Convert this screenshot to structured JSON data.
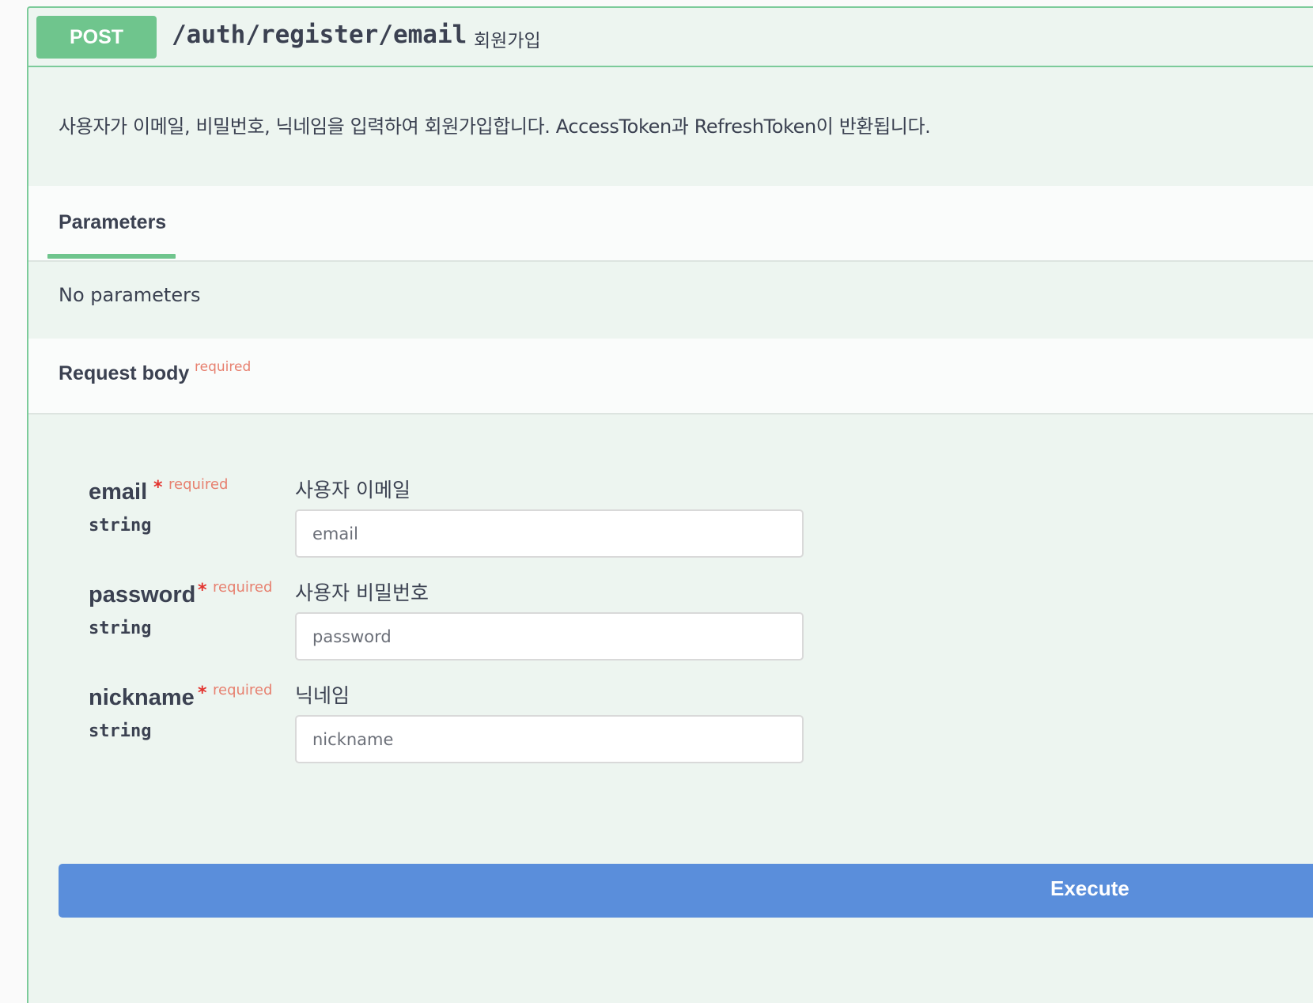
{
  "operation": {
    "method": "POST",
    "path": "/auth/register/email",
    "summary": "회원가입",
    "description": "사용자가 이메일, 비밀번호, 닉네임을 입력하여 회원가입합니다. AccessToken과 RefreshToken이 반환됩니다."
  },
  "parameters": {
    "tab_label": "Parameters",
    "empty_text": "No parameters"
  },
  "request_body": {
    "title": "Request body",
    "required_label": "required",
    "fields": [
      {
        "name": "email",
        "star": "*",
        "required": "required",
        "type": "string",
        "description": "사용자 이메일",
        "value": "",
        "placeholder": "email"
      },
      {
        "name": "password",
        "star": "*",
        "required": "required",
        "type": "string",
        "description": "사용자 비밀번호",
        "value": "",
        "placeholder": "password"
      },
      {
        "name": "nickname",
        "star": "*",
        "required": "required",
        "type": "string",
        "description": "닉네임",
        "value": "",
        "placeholder": "nickname"
      }
    ]
  },
  "actions": {
    "execute_label": "Execute"
  },
  "colors": {
    "post_accent": "#6fc58d",
    "post_bg": "#edf5f0",
    "required": "#e7806f",
    "star": "#e3342f",
    "execute": "#5a8edb"
  }
}
